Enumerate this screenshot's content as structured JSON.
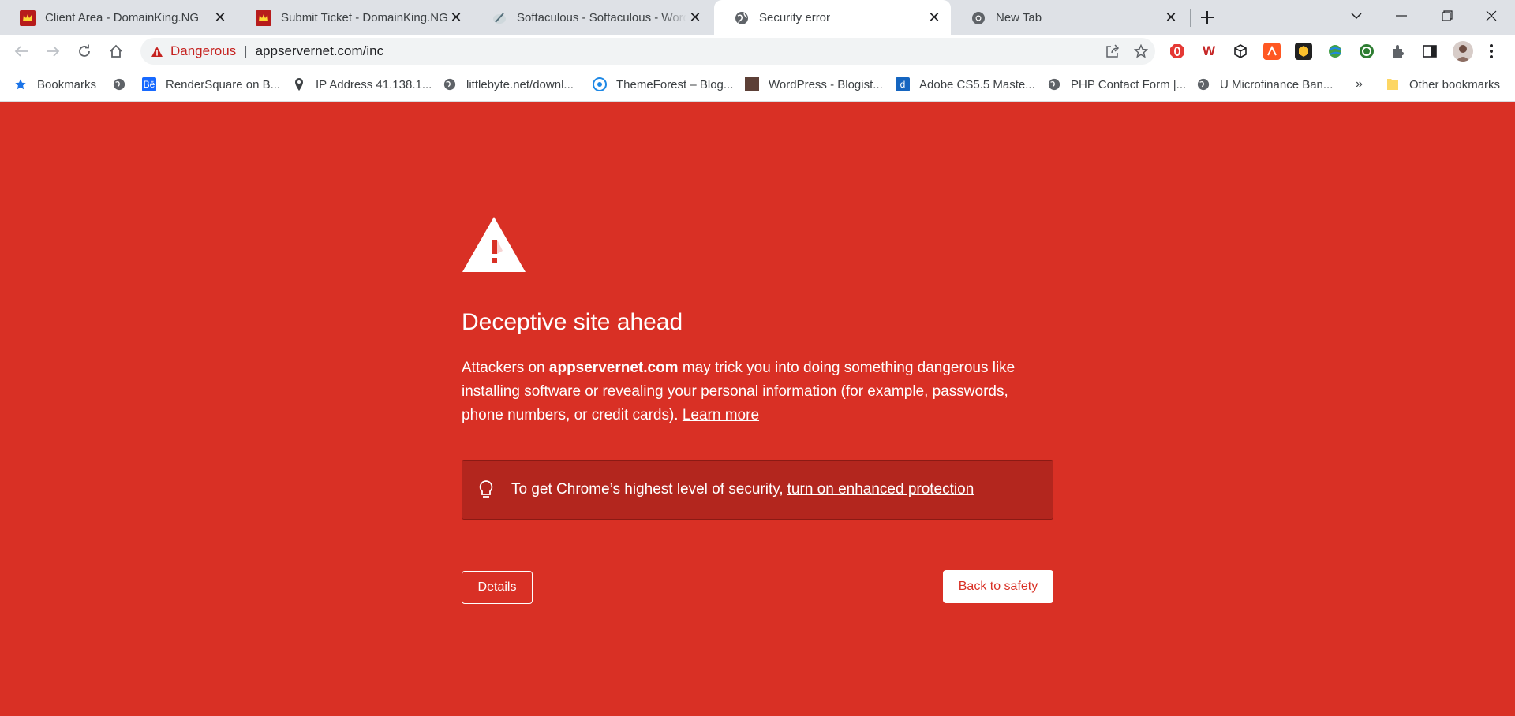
{
  "tabs": [
    {
      "title": "Client Area - DomainKing.NG"
    },
    {
      "title": "Submit Ticket - DomainKing.NG"
    },
    {
      "title": "Softaculous - Softaculous - Word"
    },
    {
      "title": "Security error"
    },
    {
      "title": "New Tab"
    }
  ],
  "omnibox": {
    "security_label": "Dangerous",
    "separator": "|",
    "url": "appservernet.com/inc"
  },
  "bookmarks": [
    {
      "label": "Bookmarks"
    },
    {
      "label": "RenderSquare on B..."
    },
    {
      "label": "IP Address 41.138.1..."
    },
    {
      "label": "littlebyte.net/downl..."
    },
    {
      "label": "ThemeForest – Blog..."
    },
    {
      "label": "WordPress - Blogist..."
    },
    {
      "label": "Adobe CS5.5 Maste..."
    },
    {
      "label": "PHP Contact Form |..."
    },
    {
      "label": "U Microfinance Ban..."
    }
  ],
  "bookmarks_overflow": "»",
  "other_bookmarks": "Other bookmarks",
  "extensions": {
    "w_label": "W"
  },
  "page": {
    "heading": "Deceptive site ahead",
    "desc_prefix": "Attackers on ",
    "desc_domain": "appservernet.com",
    "desc_suffix": " may trick you into doing something dangerous like installing software or revealing your personal information (for example, passwords, phone numbers, or credit cards). ",
    "learn_more": "Learn more",
    "enhanced_prefix": "To get Chrome’s highest level of security,",
    "enhanced_link": "turn on enhanced protection",
    "details_button": "Details",
    "back_button": "Back to safety"
  },
  "colors": {
    "background": "#d93025",
    "banner": "#b3261e",
    "dangerous_text": "#c5221f"
  },
  "icons": {
    "warning": "warning-triangle-icon",
    "lightbulb": "lightbulb-icon"
  }
}
